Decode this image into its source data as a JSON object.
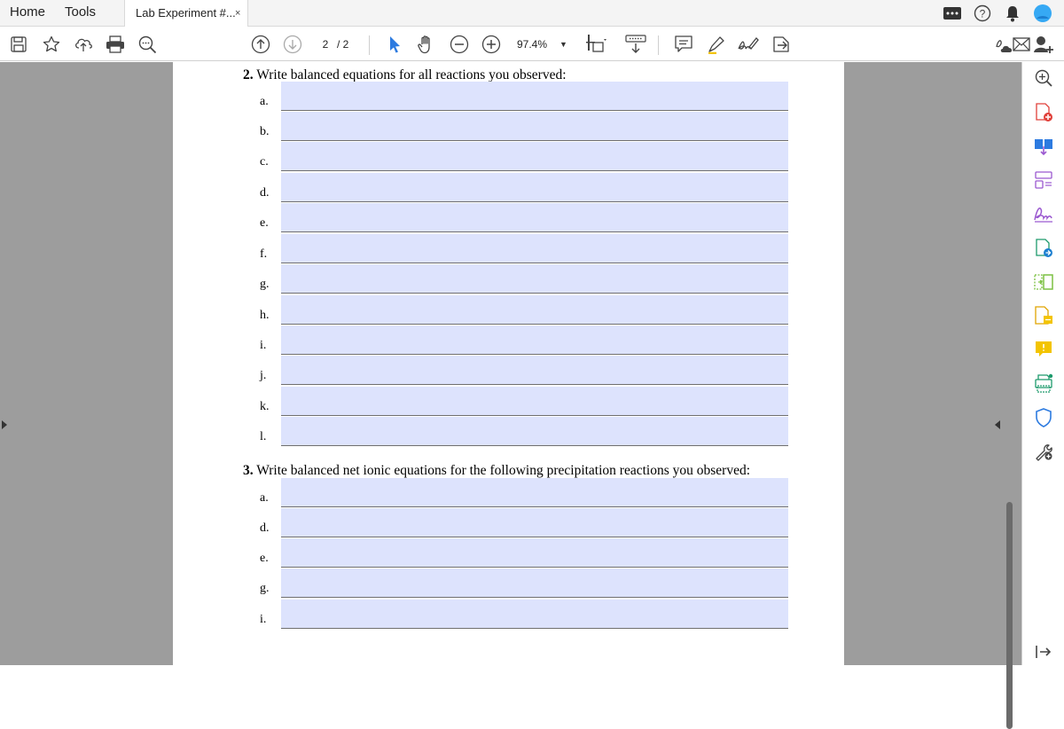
{
  "tabs": {
    "home": "Home",
    "tools": "Tools",
    "document": "Lab Experiment #...",
    "close": "×"
  },
  "toolbar": {
    "current_page": "2",
    "total_pages": "/ 2",
    "zoom": "97.4%",
    "icons": [
      "save-icon",
      "star-icon",
      "upload-icon",
      "print-icon",
      "search-icon",
      "page-up-icon",
      "page-down-icon",
      "select-arrow-icon",
      "hand-icon",
      "zoom-out-icon",
      "zoom-in-icon",
      "fit-page-icon",
      "keyboard-icon",
      "comment-icon",
      "highlight-icon",
      "sign-icon",
      "share-icon",
      "cloud-sign-icon",
      "mail-icon",
      "add-user-icon"
    ]
  },
  "document": {
    "q2": {
      "number": "2.",
      "text": "Write balanced equations for all reactions you observed:",
      "items": [
        "a.",
        "b.",
        "c.",
        "d.",
        "e.",
        "f.",
        "g.",
        "h.",
        "i.",
        "j.",
        "k.",
        "l."
      ]
    },
    "q3": {
      "number": "3.",
      "text": "Write balanced net ionic equations for the following precipitation reactions you observed:",
      "items": [
        "a.",
        "d.",
        "e.",
        "g.",
        "i."
      ]
    }
  },
  "colors": {
    "form_field": "#dde3fd",
    "workspace": "#9d9d9d",
    "accent_blue": "#2d7be0"
  },
  "right_panel_icons": [
    "zoom-icon",
    "create-pdf-icon",
    "export-pdf-icon",
    "organize-pages-icon",
    "fill-sign-icon",
    "edit-pdf-icon",
    "compress-icon",
    "request-signature-icon",
    "comment-icon",
    "scan-icon",
    "protect-icon",
    "more-tools-icon",
    "collapse-panel-icon"
  ]
}
